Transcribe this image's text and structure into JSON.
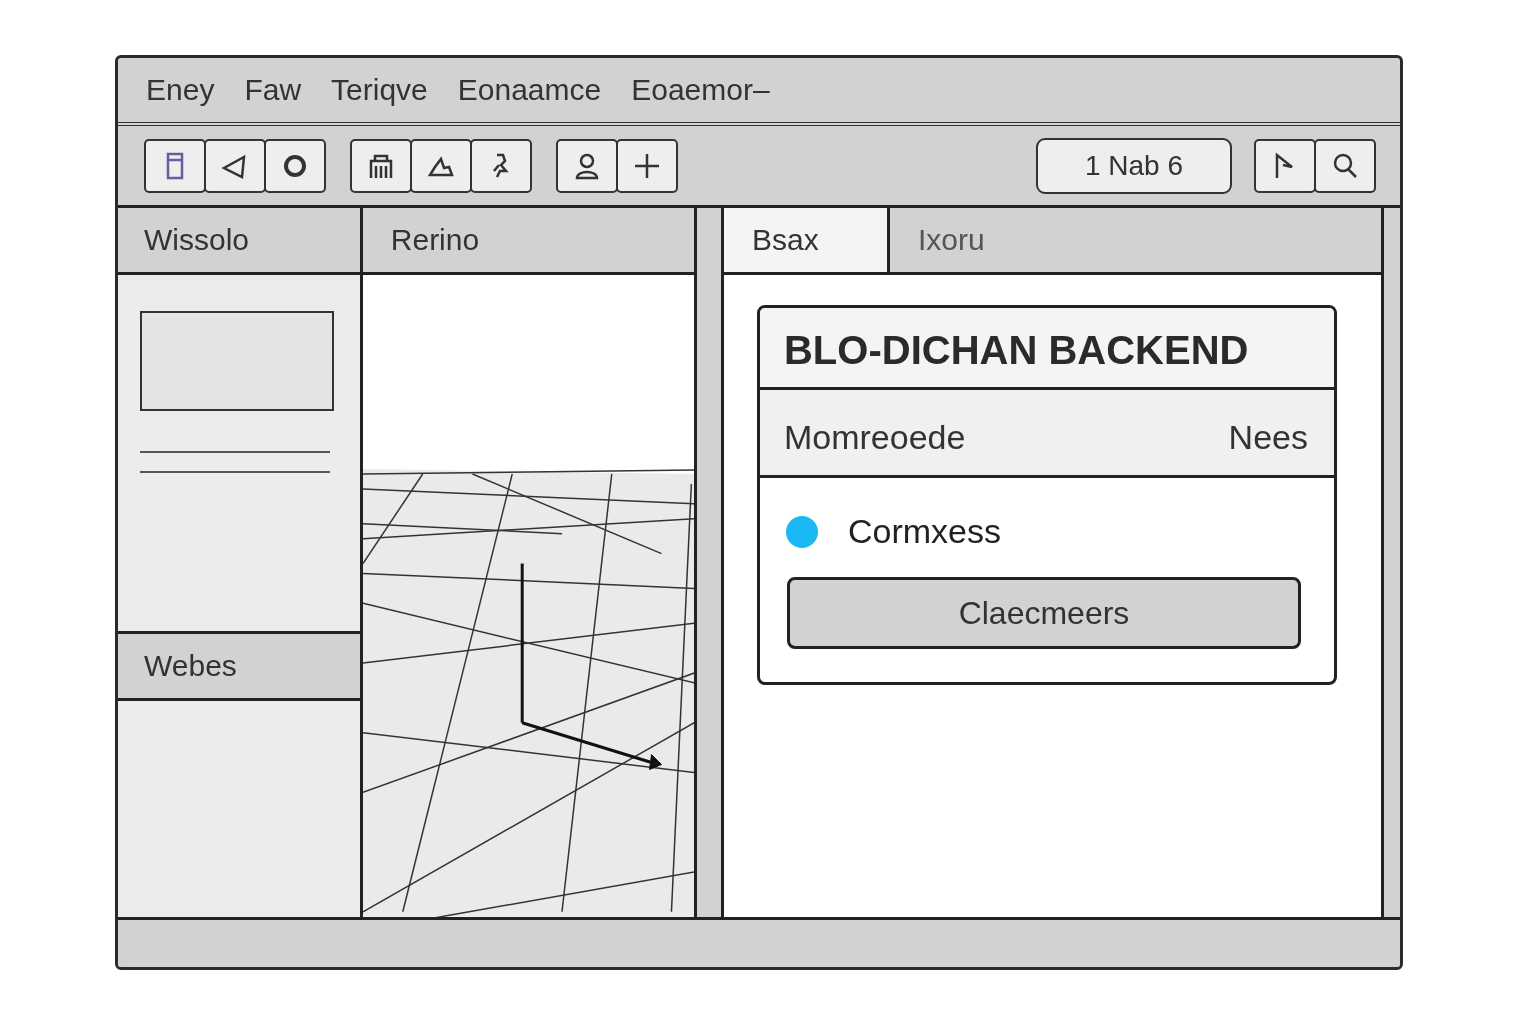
{
  "menu": [
    "Eney",
    "Faw",
    "Teriqve",
    "Eonaamce",
    "Eoaemor–"
  ],
  "toolbar": {
    "counter": "1 Nab 6"
  },
  "left_panel": {
    "title": "Wissolo",
    "section": "Webes"
  },
  "viewport": {
    "title": "Rerino"
  },
  "tabs": [
    {
      "label": "Bsax",
      "selected": true
    },
    {
      "label": "Ixoru",
      "selected": false
    }
  ],
  "card": {
    "title": "BLO-DICHAN BACKEND",
    "columns": [
      "Momreoede",
      "Nees"
    ],
    "status": {
      "label": "Cormxess",
      "color": "#1ab8f5"
    },
    "button": "Claecmeers"
  }
}
